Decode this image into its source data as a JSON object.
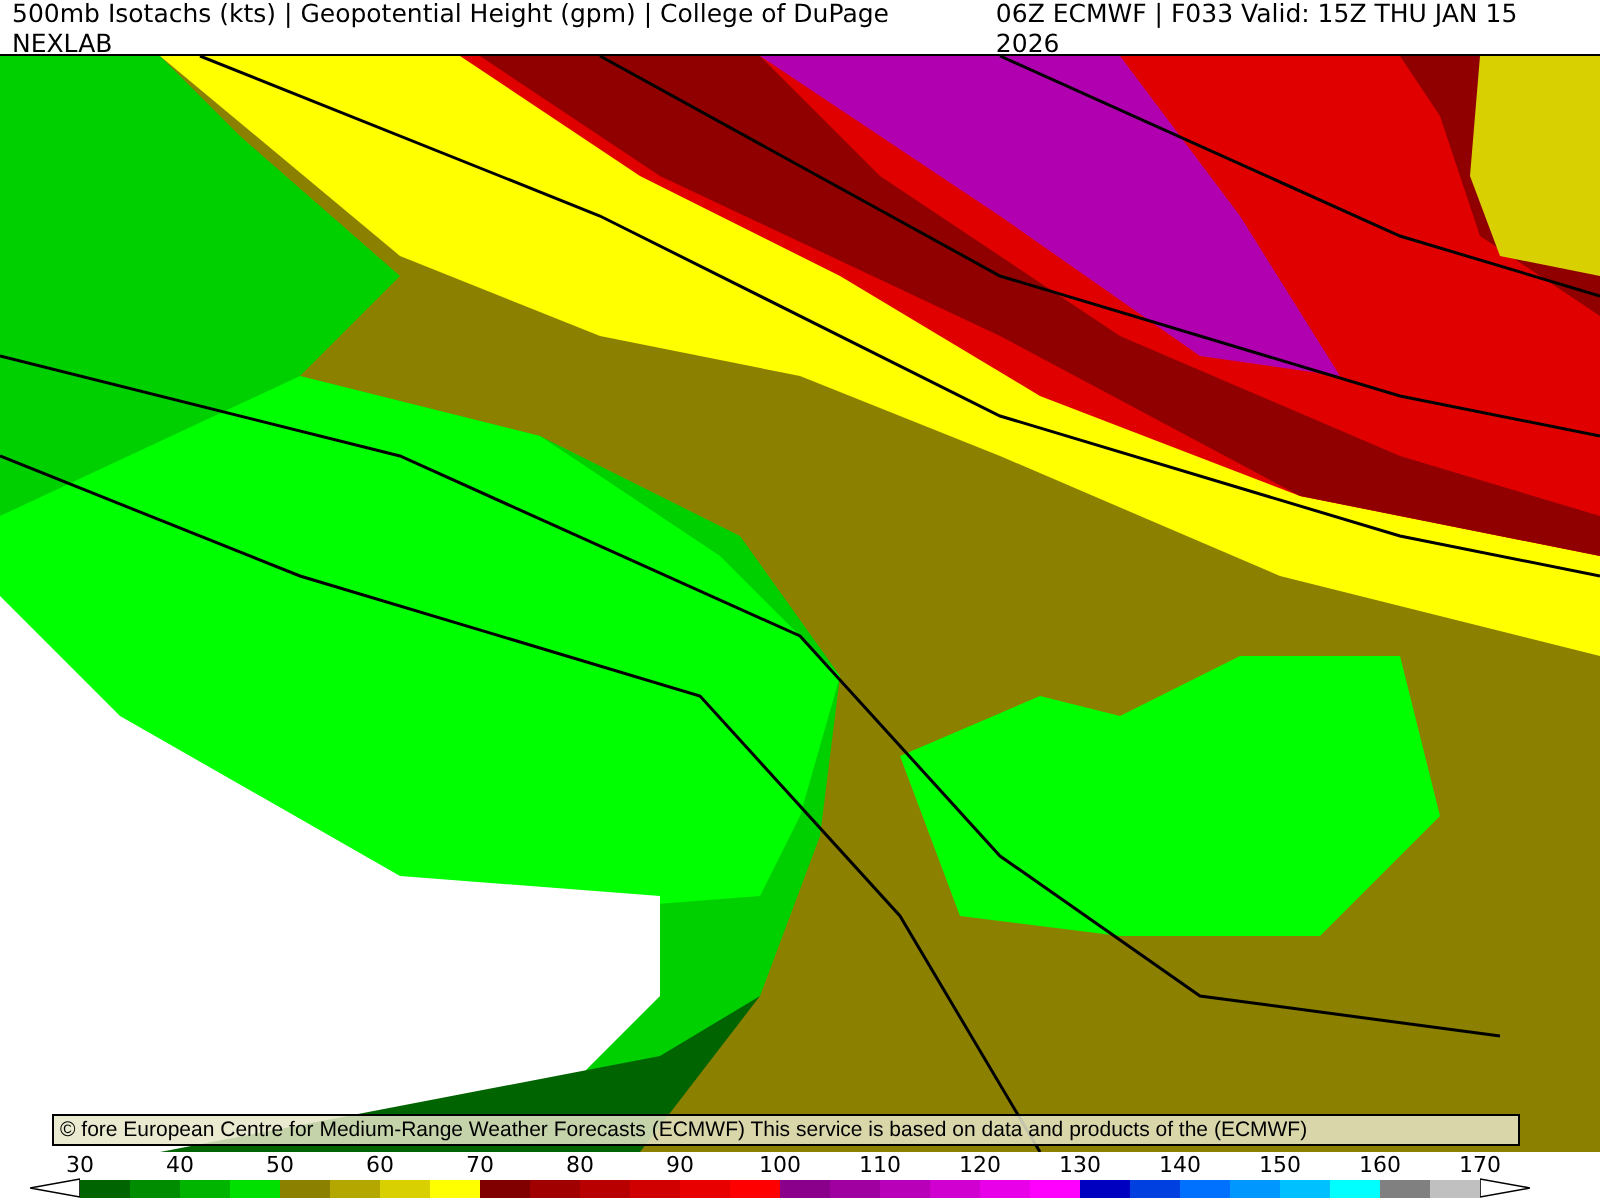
{
  "header": {
    "title": "500mb Isotachs (kts) | Geopotential Height (gpm) | College of DuPage NEXLAB",
    "run": "06Z ECMWF | F033 Valid: 15Z THU JAN 15 2026"
  },
  "map": {
    "attribution": "© fore European Centre for Medium-Range Weather Forecasts (ECMWF)  This service is based on data and products of the (ECMWF)"
  },
  "legend": {
    "ticks": [
      "30",
      "40",
      "50",
      "60",
      "70",
      "80",
      "90",
      "100",
      "110",
      "120",
      "130",
      "140",
      "150",
      "160",
      "170"
    ],
    "bins": [
      {
        "color": "#006400"
      },
      {
        "color": "#008c00"
      },
      {
        "color": "#00b400"
      },
      {
        "color": "#00e000"
      },
      {
        "color": "#8b8000"
      },
      {
        "color": "#b4a800"
      },
      {
        "color": "#d8d000"
      },
      {
        "color": "#ffff00"
      },
      {
        "color": "#800000"
      },
      {
        "color": "#a00000"
      },
      {
        "color": "#b80000"
      },
      {
        "color": "#d00000"
      },
      {
        "color": "#e80000"
      },
      {
        "color": "#ff0000"
      },
      {
        "color": "#8b008b"
      },
      {
        "color": "#a000a0"
      },
      {
        "color": "#b800b8"
      },
      {
        "color": "#d000d0"
      },
      {
        "color": "#e800e8"
      },
      {
        "color": "#ff00ff"
      },
      {
        "color": "#0000c0"
      },
      {
        "color": "#0040e0"
      },
      {
        "color": "#0070ff"
      },
      {
        "color": "#0098ff"
      },
      {
        "color": "#00c0ff"
      },
      {
        "color": "#00ffff"
      },
      {
        "color": "#808080"
      },
      {
        "color": "#c0c0c0"
      }
    ]
  }
}
